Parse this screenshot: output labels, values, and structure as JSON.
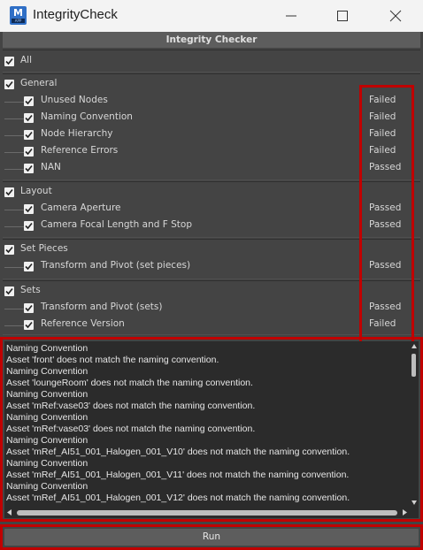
{
  "window": {
    "title": "IntegrityCheck",
    "icon_letter": "M",
    "icon_sub": "APP",
    "icon": "maya-app-icon"
  },
  "header": {
    "title": "Integrity Checker"
  },
  "all": {
    "label": "All",
    "checked": true
  },
  "groups": [
    {
      "label": "General",
      "checked": true,
      "items": [
        {
          "label": "Unused Nodes",
          "status": "Failed",
          "checked": true
        },
        {
          "label": "Naming Convention",
          "status": "Failed",
          "checked": true
        },
        {
          "label": "Node Hierarchy",
          "status": "Failed",
          "checked": true
        },
        {
          "label": "Reference Errors",
          "status": "Failed",
          "checked": true
        },
        {
          "label": "NAN",
          "status": "Passed",
          "checked": true
        }
      ]
    },
    {
      "label": "Layout",
      "checked": true,
      "items": [
        {
          "label": "Camera Aperture",
          "status": "Passed",
          "checked": true
        },
        {
          "label": "Camera Focal Length and F Stop",
          "status": "Passed",
          "checked": true
        }
      ]
    },
    {
      "label": "Set Pieces",
      "checked": true,
      "items": [
        {
          "label": "Transform and Pivot (set pieces)",
          "status": "Passed",
          "checked": true
        }
      ]
    },
    {
      "label": "Sets",
      "checked": true,
      "items": [
        {
          "label": "Transform and Pivot (sets)",
          "status": "Passed",
          "checked": true
        },
        {
          "label": "Reference Version",
          "status": "Failed",
          "checked": true
        }
      ]
    }
  ],
  "log": [
    "Naming Convention",
    "Asset 'front' does not match the naming convention.",
    "Naming Convention",
    "Asset 'loungeRoom' does not match the naming convention.",
    "Naming Convention",
    "Asset 'mRef:vase03' does not match the naming convention.",
    "Naming Convention",
    "Asset 'mRef:vase03' does not match the naming convention.",
    "Naming Convention",
    "Asset 'mRef_AI51_001_Halogen_001_V10' does not match the naming convention.",
    "Naming Convention",
    "Asset 'mRef_AI51_001_Halogen_001_V11' does not match the naming convention.",
    "Naming Convention",
    "Asset 'mRef_AI51_001_Halogen_001_V12' does not match the naming convention."
  ],
  "run_button": {
    "label": "Run"
  },
  "colors": {
    "highlight": "#c00000",
    "panel_bg": "#444444",
    "header_bg": "#5d5d5d",
    "log_bg": "#2b2b2b"
  }
}
